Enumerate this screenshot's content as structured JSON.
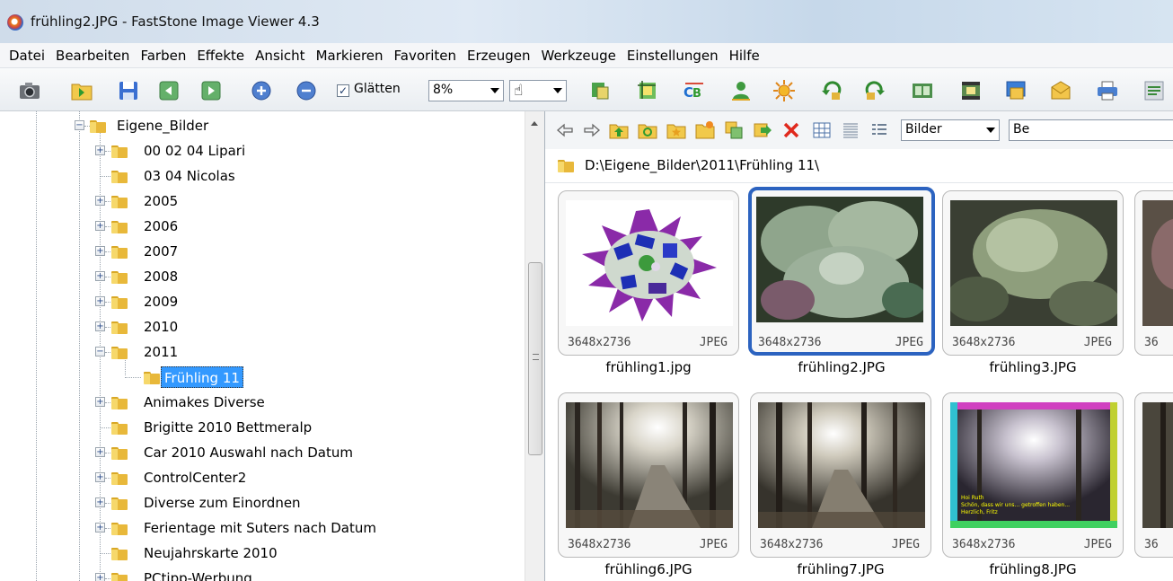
{
  "window": {
    "title": "frühling2.JPG  -  FastStone Image Viewer 4.3"
  },
  "menu": [
    "Datei",
    "Bearbeiten",
    "Farben",
    "Effekte",
    "Ansicht",
    "Markieren",
    "Favoriten",
    "Erzeugen",
    "Werkzeuge",
    "Einstellungen",
    "Hilfe"
  ],
  "toolbar": {
    "smooth_label": "Glätten",
    "smooth_checked": true,
    "zoom_value": "8%"
  },
  "tree": {
    "root": "Eigene_Bilder",
    "items": [
      {
        "label": "00 02 04 Lipari"
      },
      {
        "label": "03 04 Nicolas"
      },
      {
        "label": "2005"
      },
      {
        "label": "2006"
      },
      {
        "label": "2007"
      },
      {
        "label": "2008"
      },
      {
        "label": "2009"
      },
      {
        "label": "2010"
      },
      {
        "label": "2011"
      },
      {
        "label": "Frühling 11"
      },
      {
        "label": "Animakes Diverse"
      },
      {
        "label": "Brigitte 2010 Bettmeralp"
      },
      {
        "label": "Car 2010 Auswahl nach Datum"
      },
      {
        "label": "ControlCenter2"
      },
      {
        "label": "Diverse zum Einordnen"
      },
      {
        "label": "Ferientage mit Suters nach Datum"
      },
      {
        "label": "Neujahrskarte 2010"
      },
      {
        "label": "PCtipp-Werbung"
      }
    ]
  },
  "browser": {
    "filter_value": "Bilder",
    "sort_value": "Be",
    "path": "D:\\Eigene_Bilder\\2011\\Frühling 11\\",
    "thumbnails": [
      {
        "name": "frühling1.jpg",
        "dims": "3648x2736",
        "format": "JPEG"
      },
      {
        "name": "frühling2.JPG",
        "dims": "3648x2736",
        "format": "JPEG"
      },
      {
        "name": "frühling3.JPG",
        "dims": "3648x2736",
        "format": "JPEG"
      },
      {
        "name": "frühling6.JPG",
        "dims": "3648x2736",
        "format": "JPEG"
      },
      {
        "name": "frühling7.JPG",
        "dims": "3648x2736",
        "format": "JPEG"
      },
      {
        "name": "frühling8.JPG",
        "dims": "3648x2736",
        "format": "JPEG"
      }
    ],
    "partial_dims": "36",
    "overlay_text_line1": "Hoi Ruth",
    "overlay_text_line2": "Schön, dass wir uns... getroffen haben...",
    "overlay_text_line3": "Herzlich, Fritz"
  }
}
